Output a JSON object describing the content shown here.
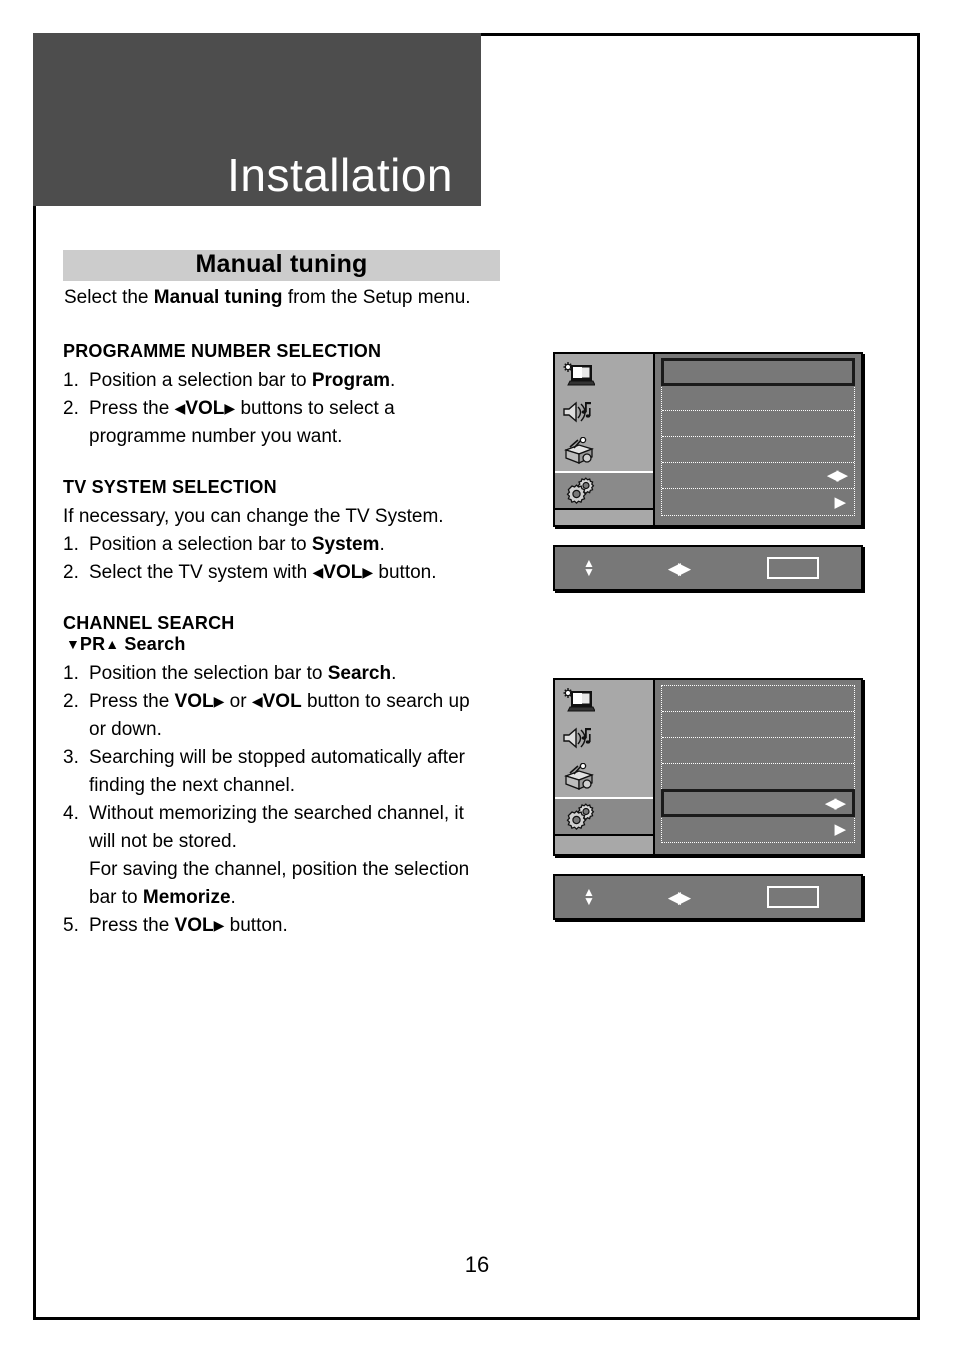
{
  "chapter": {
    "title": "Installation"
  },
  "section": {
    "title": "Manual tuning"
  },
  "lead": {
    "before": "Select the ",
    "bold": "Manual tuning",
    "after": " from the Setup menu."
  },
  "programme_number_selection": {
    "heading": "PROGRAMME NUMBER SELECTION",
    "steps": [
      {
        "num": "1.",
        "parts": [
          {
            "t": "Position a selection bar to "
          },
          {
            "t": "Program",
            "b": true
          },
          {
            "t": "."
          }
        ]
      },
      {
        "num": "2.",
        "parts": [
          {
            "t": "Press the  "
          },
          {
            "t": "◀",
            "icon": "left-triangle-icon"
          },
          {
            "t": "VOL",
            "b": true
          },
          {
            "t": "▶",
            "icon": "right-triangle-icon"
          },
          {
            "t": " buttons to select a"
          }
        ],
        "cont": "programme number you want."
      }
    ]
  },
  "tv_system_selection": {
    "heading": "TV SYSTEM SELECTION",
    "intro": "If necessary, you can change the TV System.",
    "steps": [
      {
        "num": "1.",
        "parts": [
          {
            "t": "Position a selection bar to "
          },
          {
            "t": "System",
            "b": true
          },
          {
            "t": "."
          }
        ]
      },
      {
        "num": "2.",
        "parts": [
          {
            "t": "Select the TV system with  "
          },
          {
            "t": "◀",
            "icon": "left-triangle-icon"
          },
          {
            "t": "VOL",
            "b": true
          },
          {
            "t": "▶",
            "icon": "right-triangle-icon"
          },
          {
            "t": " button."
          }
        ]
      }
    ]
  },
  "channel_search": {
    "heading": "CHANNEL SEARCH",
    "subheading_parts": [
      {
        "t": "▼",
        "icon": "down-triangle-icon"
      },
      {
        "t": "PR",
        "b": true
      },
      {
        "t": "▲",
        "icon": "up-triangle-icon"
      },
      {
        "t": " Search",
        "b": true
      }
    ],
    "steps": [
      {
        "num": "1.",
        "parts": [
          {
            "t": "Position the selection bar to "
          },
          {
            "t": "Search",
            "b": true
          },
          {
            "t": "."
          }
        ]
      },
      {
        "num": "2.",
        "parts": [
          {
            "t": "Press the "
          },
          {
            "t": "VOL",
            "b": true
          },
          {
            "t": "▶",
            "icon": "right-triangle-icon"
          },
          {
            "t": " or  "
          },
          {
            "t": "◀",
            "icon": "left-triangle-icon"
          },
          {
            "t": "VOL",
            "b": true
          },
          {
            "t": " button to search up"
          }
        ],
        "cont": "or down."
      },
      {
        "num": "3.",
        "parts": [
          {
            "t": "Searching will be stopped automatically after"
          }
        ],
        "cont": "finding the next channel."
      },
      {
        "num": "4.",
        "parts": [
          {
            "t": "Without memorizing the searched channel, it"
          }
        ],
        "cont": "will not be stored.",
        "cont2_parts": [
          {
            "t": "For saving the channel, position the selection"
          }
        ],
        "cont3_parts": [
          {
            "t": "bar to "
          },
          {
            "t": "Memorize",
            "b": true
          },
          {
            "t": "."
          }
        ]
      },
      {
        "num": "5.",
        "parts": [
          {
            "t": "Press the "
          },
          {
            "t": "VOL",
            "b": true
          },
          {
            "t": "▶",
            "icon": "right-triangle-icon"
          },
          {
            "t": " button."
          }
        ]
      }
    ]
  },
  "osd": {
    "sidebar_icons": [
      {
        "name": "picture-icon"
      },
      {
        "name": "sound-icon"
      },
      {
        "name": "feature-icon"
      },
      {
        "name": "setup-icon"
      }
    ],
    "menu_top": {
      "rows": 6,
      "highlight_row": 1,
      "row_markers": {
        "5": "left-right-arrow",
        "6": "right-arrow"
      }
    },
    "menu_bottom": {
      "rows": 6,
      "highlight_row": 5,
      "row_markers": {
        "5": "left-right-arrow",
        "6": "right-arrow"
      }
    },
    "help_bar": {
      "updown_glyphs": "▲▼",
      "leftright_glyphs": "◀▶",
      "box_label": ""
    }
  },
  "colors": {
    "header_block": "#4d4d4d",
    "section_bar": "#cccccc",
    "osd_sidebar": "#a8a8a8",
    "osd_sidebar_selected": "#8a8a8a",
    "osd_panel": "#787878",
    "osd_outline": "#000000",
    "text": "#000000"
  },
  "page_number": "16"
}
